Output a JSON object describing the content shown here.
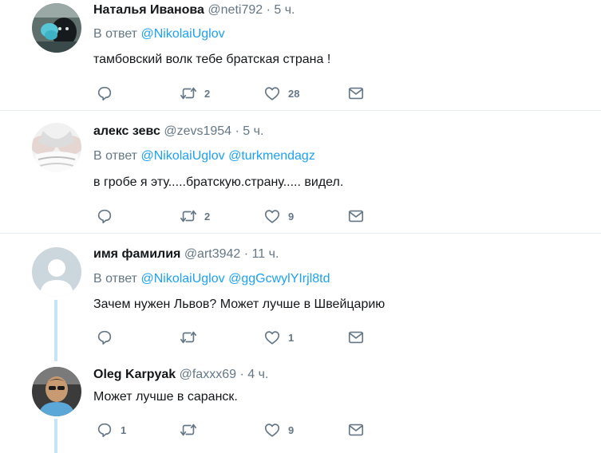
{
  "reply_prefix": "В ответ",
  "tweets": [
    {
      "name": "Наталья Иванова",
      "handle": "@neti792",
      "separator": "·",
      "time": "5 ч.",
      "mentions": [
        "@NikolaiUglov"
      ],
      "text": "тамбовский волк тебе братская страна !",
      "reply_count": "",
      "retweet_count": "2",
      "like_count": "28"
    },
    {
      "name": "алекс зевс",
      "handle": "@zevs1954",
      "separator": "·",
      "time": "5 ч.",
      "mentions": [
        "@NikolaiUglov",
        "@turkmendagz"
      ],
      "text": "в гробе я  эту.....братскую.страну..... видел.",
      "reply_count": "",
      "retweet_count": "2",
      "like_count": "9"
    },
    {
      "name": "имя фамилия",
      "handle": "@art3942",
      "separator": "·",
      "time": "11 ч.",
      "mentions": [
        "@NikolaiUglov",
        "@ggGcwylYIrjl8td"
      ],
      "text": "Зачем нужен Львов? Может лучше в Швейцарию",
      "reply_count": "",
      "retweet_count": "",
      "like_count": "1"
    },
    {
      "name": "Oleg Karpyak",
      "handle": "@faxxx69",
      "separator": "·",
      "time": "4 ч.",
      "mentions": [],
      "text": "Может лучше в саранск.",
      "reply_count": "1",
      "retweet_count": "",
      "like_count": "9"
    }
  ],
  "icons": {
    "reply": "reply-icon",
    "retweet": "retweet-icon",
    "like": "heart-icon",
    "message": "envelope-icon"
  },
  "colors": {
    "link": "#1da1f2",
    "muted": "#657786",
    "thread_line": "#c5e4f9",
    "divider": "#e6ecf0"
  }
}
